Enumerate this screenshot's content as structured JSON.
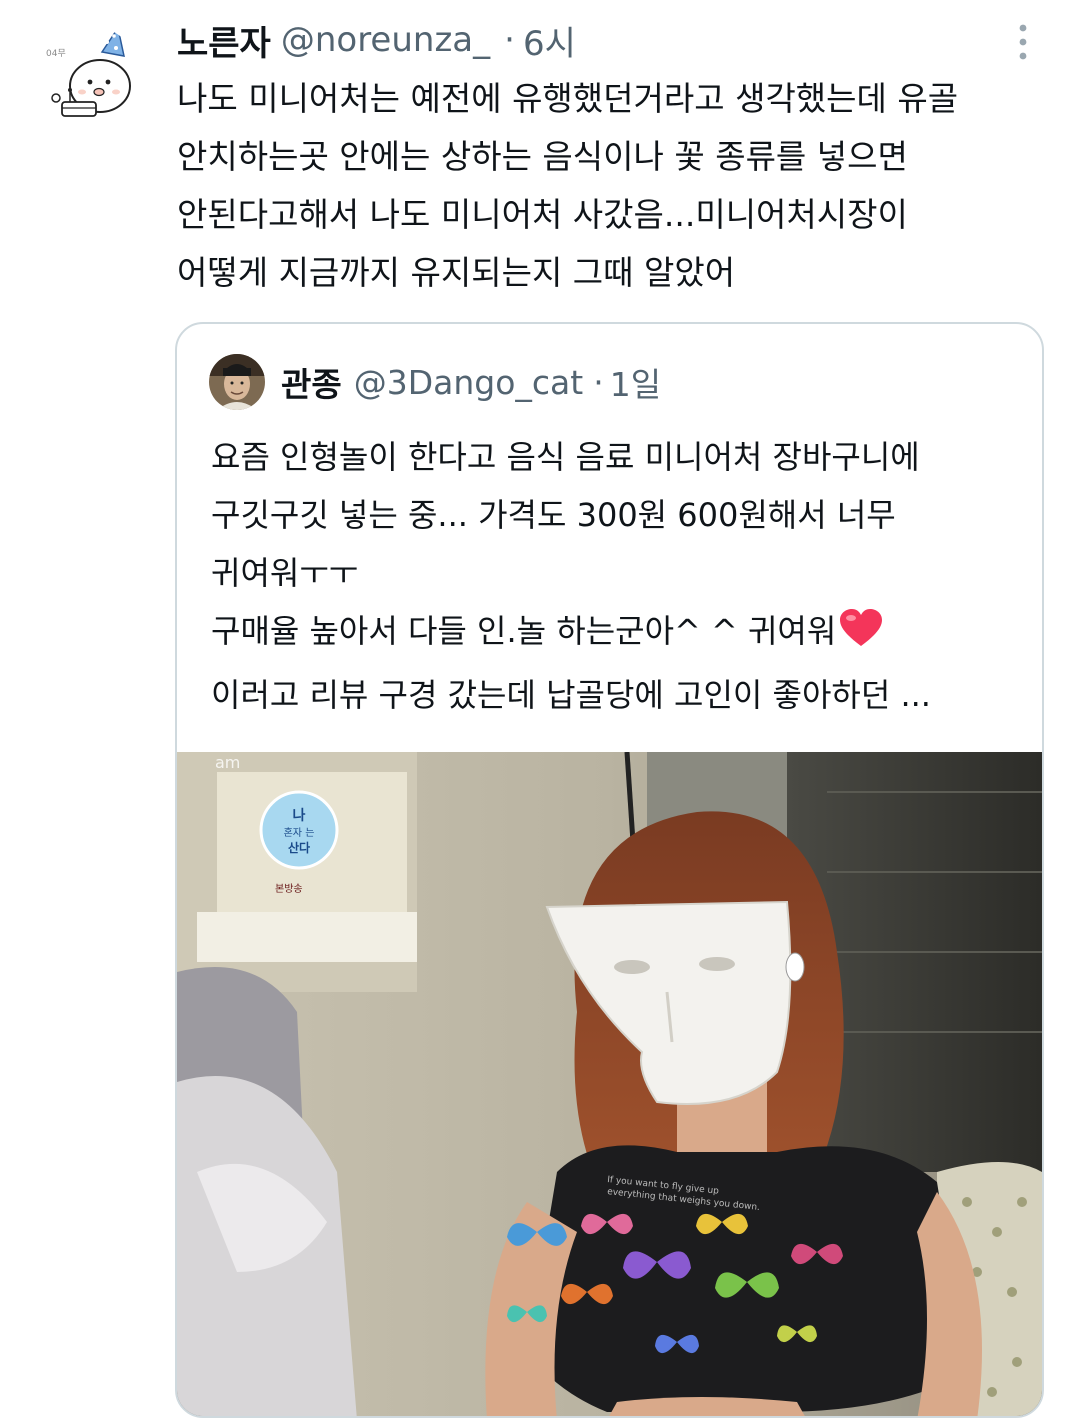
{
  "tweet": {
    "display_name": "노른자",
    "handle": "@noreunza_",
    "separator": "·",
    "time": "6시",
    "avatar_label": "04무",
    "text_lines": [
      "나도 미니어처는 예전에 유행했던거라고 생각했는데 유골",
      "안치하는곳 안에는 상하는 음식이나 꽃 종류를 넣으면",
      "안된다고해서 나도 미니어처 사갔음...미니어처시장이",
      "어떻게 지금까지 유지되는지 그때 알았어"
    ]
  },
  "quote": {
    "display_name": "관종",
    "handle": "@3Dango_cat",
    "separator": "·",
    "time": "1일",
    "text_lines": [
      "요즘 인형놀이 한다고 음식 음료 미니어처 장바구니에",
      "구깃구깃 넣는 중...  가격도 300원 600원해서 너무",
      "귀여워ㅜㅜ",
      "구매율 높아서 다들 인.놀 하는군아^ ^ 귀여워",
      "이러고 리뷰 구경 갔는데 납골당에 고인이 좋아하던 ..."
    ],
    "media": {
      "watermark": "am",
      "show_logo_lines": [
        "나",
        "혼자 는",
        "산다"
      ],
      "tag": "본방송",
      "shirt_text": [
        "If you want to fly give up",
        "everything that weighs you down."
      ]
    }
  },
  "colors": {
    "text_primary": "#0f1419",
    "text_secondary": "#536471",
    "border": "#cfd9de",
    "heart": "#f4355a"
  },
  "icons": {
    "more": "more-vertical-icon",
    "heart": "red-heart-icon"
  }
}
